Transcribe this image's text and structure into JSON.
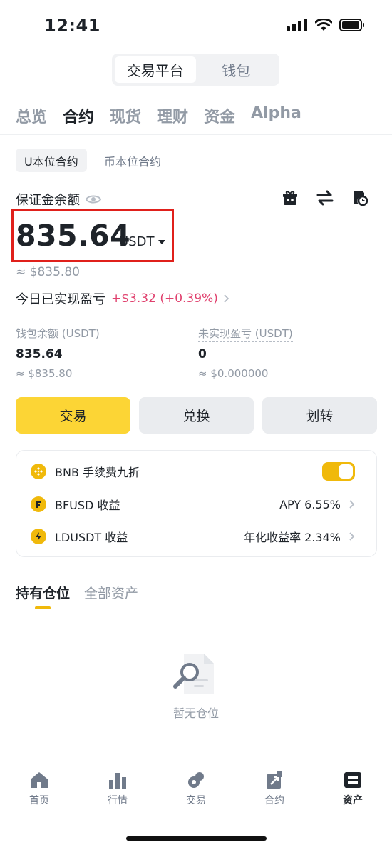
{
  "status_bar": {
    "time": "12:41"
  },
  "segment": {
    "active": "交易平台",
    "inactive": "钱包"
  },
  "top_tabs": [
    "总览",
    "合约",
    "现货",
    "理财",
    "资金",
    "Alpha"
  ],
  "active_top_tab": "合约",
  "sub_tabs": {
    "active": "U本位合约",
    "inactive": "币本位合约"
  },
  "margin": {
    "label": "保证金余额",
    "value": "835.64",
    "unit": "USDT",
    "approx": "≈ $835.80"
  },
  "pnl": {
    "label": "今日已实现盈亏",
    "value": "+$3.32 (+0.39%)",
    "color": "#e0416e"
  },
  "stats": {
    "wallet": {
      "label": "钱包余额 (USDT)",
      "value": "835.64",
      "approx": "≈ $835.80"
    },
    "unrealized": {
      "label": "未实现盈亏 (USDT)",
      "value": "0",
      "approx": "≈ $0.000000"
    }
  },
  "actions": {
    "trade": "交易",
    "convert": "兑换",
    "transfer": "划转"
  },
  "card": {
    "bnb": {
      "label": "BNB 手续费九折",
      "toggle_on": true
    },
    "bfusd": {
      "label": "BFUSD 收益",
      "value": "APY 6.55%"
    },
    "ldusdt": {
      "label": "LDUSDT 收益",
      "value": "年化收益率 2.34%"
    }
  },
  "positions": {
    "active_tab": "持有仓位",
    "other_tab": "全部资产",
    "empty_text": "暂无仓位"
  },
  "bottom_nav": {
    "home": "首页",
    "markets": "行情",
    "trade": "交易",
    "futures": "合约",
    "assets": "资产"
  },
  "colors": {
    "accent": "#fcd535",
    "brand": "#f0b90b",
    "highlight_box": "#e0201b"
  }
}
